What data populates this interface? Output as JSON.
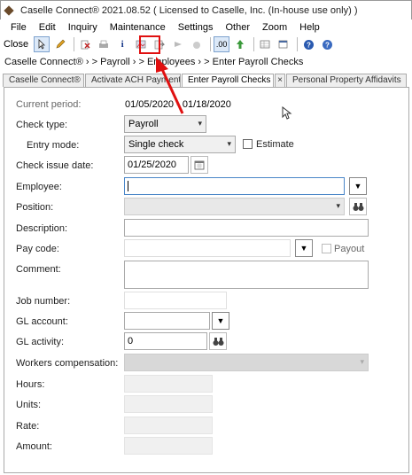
{
  "window": {
    "title": "Caselle Connect® 2021.08.52    ( Licensed to Caselle, Inc. (In-house use only) )"
  },
  "menu": [
    "File",
    "Edit",
    "Inquiry",
    "Maintenance",
    "Settings",
    "Other",
    "Zoom",
    "Help"
  ],
  "toolbar": {
    "close_label": "Close",
    "decimal_label": ".00",
    "icons": [
      "arrow-cursor-icon",
      "pencil-icon",
      "delete-icon",
      "print-icon",
      "info-icon",
      "image-icon",
      "process-icon",
      "forward-icon",
      "hand-icon",
      "decimal-icon",
      "upload-icon",
      "grid-icon",
      "window-icon",
      "help-icon",
      "settings-help-icon"
    ]
  },
  "breadcrumb": "Caselle Connect®  ›  >  Payroll  ›  >  Employees  ›  >  Enter Payroll Checks",
  "tabs": [
    {
      "label": "Caselle Connect®"
    },
    {
      "label": "Activate ACH Payments"
    },
    {
      "label": "Enter Payroll Checks"
    },
    {
      "label": "Personal Property Affidavits"
    }
  ],
  "form": {
    "current_period_label": "Current period:",
    "current_period_value": "01/05/2020 - 01/18/2020",
    "check_type_label": "Check type:",
    "check_type_value": "Payroll",
    "entry_mode_label": "Entry mode:",
    "entry_mode_value": "Single check",
    "estimate_label": "Estimate",
    "check_issue_date_label": "Check issue date:",
    "check_issue_date_value": "01/25/2020",
    "employee_label": "Employee:",
    "position_label": "Position:",
    "description_label": "Description:",
    "pay_code_label": "Pay code:",
    "payout_label": "Payout",
    "comment_label": "Comment:",
    "job_number_label": "Job number:",
    "gl_account_label": "GL account:",
    "gl_activity_label": "GL activity:",
    "gl_activity_value": "0",
    "workers_comp_label": "Workers compensation:",
    "hours_label": "Hours:",
    "units_label": "Units:",
    "rate_label": "Rate:",
    "amount_label": "Amount:"
  },
  "colors": {
    "highlight": "#e01010",
    "arrow": "#e01010",
    "focus_border": "#4a86c8"
  }
}
